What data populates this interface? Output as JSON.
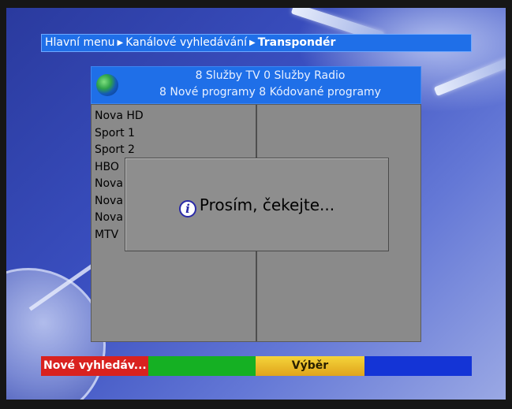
{
  "breadcrumb": {
    "items": [
      "Hlavní menu",
      "Kanálové vyhledávání",
      "Transpondér"
    ],
    "separator": "▶"
  },
  "info": {
    "line1": "8 Služby TV  0  Služby Radio",
    "line2": "8 Nové programy 8 Kódované programy"
  },
  "channels": [
    "Nova HD",
    "Sport 1",
    "Sport 2",
    "HBO",
    "Nova",
    "Nova",
    "Nova",
    "MTV"
  ],
  "dialog": {
    "message": "Prosím, čekejte..."
  },
  "colorbar": {
    "red_label": "Nové vyhledáv...",
    "yellow_label": "Výběr"
  },
  "colors": {
    "breadcrumb_bg": "#1f6fe8",
    "panel_bg": "#8a8a8a",
    "red": "#d9221f",
    "green": "#15b023",
    "yellow": "#f4d43a",
    "blue": "#1434d6"
  },
  "icons": {
    "globe": "globe-icon",
    "info": "info-icon"
  }
}
